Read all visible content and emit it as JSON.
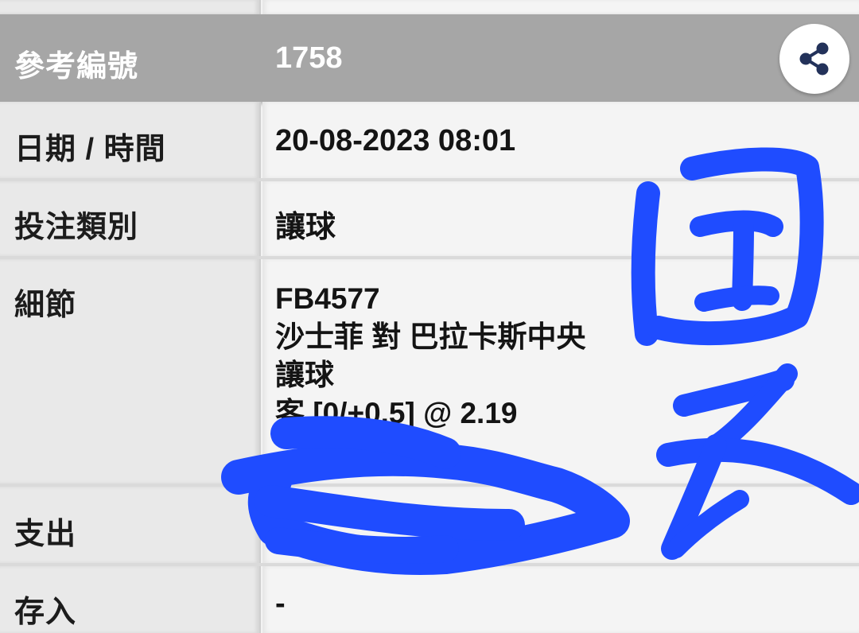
{
  "header": {
    "ref_label": "參考編號",
    "ref_value": "1758",
    "share_icon": "share-icon"
  },
  "rows": {
    "datetime": {
      "label": "日期 / 時間",
      "value": "20-08-2023 08:01"
    },
    "bet_type": {
      "label": "投注類別",
      "value": "讓球"
    },
    "details": {
      "label": "細節",
      "lines": [
        "FB4577",
        "沙士菲 對 巴拉卡斯中央",
        "讓球",
        "客 [0/+0.5] @ 2.19"
      ]
    },
    "expense": {
      "label": "支出"
    },
    "deposit": {
      "label": "存入",
      "value": "-"
    }
  },
  "colors": {
    "header_bg": "#a6a6a6",
    "ink_blue": "#1f4cff"
  }
}
